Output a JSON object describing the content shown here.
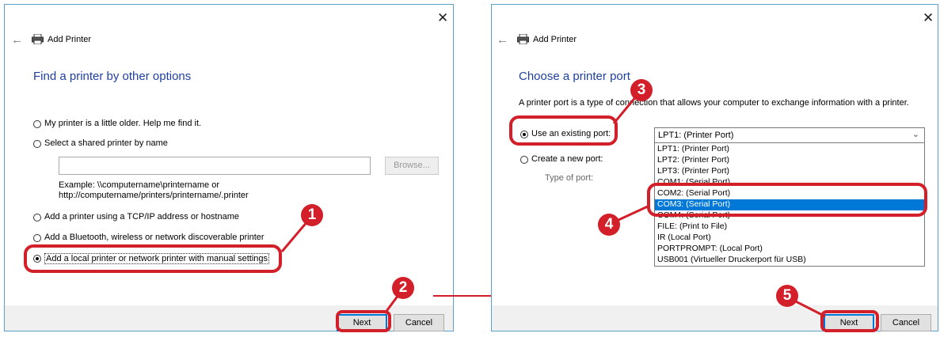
{
  "left_dialog": {
    "title": "Add Printer",
    "close_glyph": "✕",
    "back_glyph": "←",
    "heading": "Find a printer by other options",
    "options": [
      {
        "label": "My printer is a little older. Help me find it.",
        "selected": false
      },
      {
        "label": "Select a shared printer by name",
        "selected": false
      },
      {
        "label": "Add a printer using a TCP/IP address or hostname",
        "selected": false
      },
      {
        "label": "Add a Bluetooth, wireless or network discoverable printer",
        "selected": false
      },
      {
        "label": "Add a local printer or network printer with manual settings",
        "selected": true
      }
    ],
    "shared_name_value": "",
    "browse_label": "Browse...",
    "example_line1": "Example: \\\\computername\\printername or",
    "example_line2": "http://computername/printers/printername/.printer",
    "next_label": "Next",
    "cancel_label": "Cancel"
  },
  "right_dialog": {
    "title": "Add Printer",
    "close_glyph": "✕",
    "back_glyph": "←",
    "heading": "Choose a printer port",
    "description": "A printer port is a type of connection that allows your computer to exchange information with a printer.",
    "use_existing_label": "Use an existing port:",
    "create_new_label": "Create a new port:",
    "type_of_port_label": "Type of port:",
    "selected_port": "LPT1: (Printer Port)",
    "ports": [
      "LPT1: (Printer Port)",
      "LPT2: (Printer Port)",
      "LPT3: (Printer Port)",
      "COM1: (Serial Port)",
      "COM2: (Serial Port)",
      "COM3: (Serial Port)",
      "COM4: (Serial Port)",
      "FILE: (Print to File)",
      "IR (Local Port)",
      "PORTPROMPT: (Local Port)",
      "USB001 (Virtueller Druckerport für USB)"
    ],
    "highlighted_port": "COM3: (Serial Port)",
    "next_label": "Next",
    "cancel_label": "Cancel"
  },
  "callouts": [
    "1",
    "2",
    "3",
    "4",
    "5"
  ],
  "annotation_color": "#d21f2a",
  "accent_color": "#0078d7",
  "heading_color": "#1f3fa0"
}
